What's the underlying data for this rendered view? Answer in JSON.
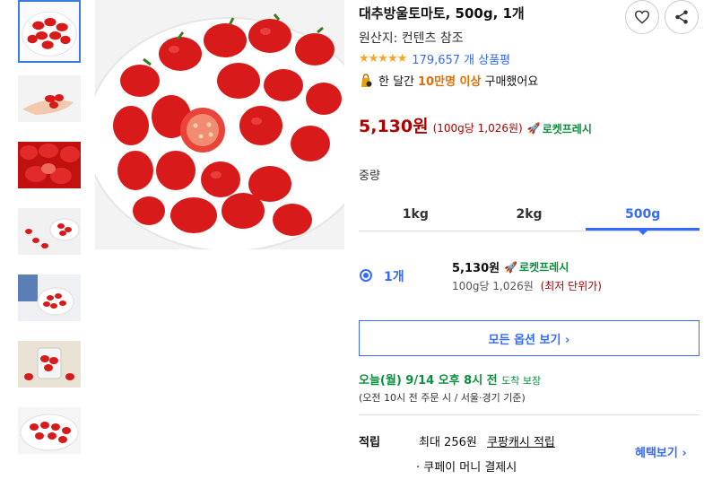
{
  "product": {
    "title": "대추방울토마토, 500g, 1개",
    "origin": "원산지: 컨텐츠 참조",
    "rating_stars": "★★★★★",
    "review_count": "179,657 개 상품평",
    "popular_prefix": "한 달간",
    "popular_highlight": "10만명 이상",
    "popular_suffix": "구매했어요"
  },
  "price": {
    "amount": "5,130원",
    "unit_price": "(100g당 1,026원)",
    "rocket_label": "로켓프레시"
  },
  "options": {
    "label": "중량",
    "tabs": [
      "1kg",
      "2kg",
      "500g"
    ],
    "selected_tab": "500g",
    "selected": {
      "qty": "1개",
      "price": "5,130원",
      "rocket_label": "로켓프레시",
      "unit": "100g당 1,026원",
      "lowest": "(최저 단위가)"
    },
    "all_options_label": "모든 옵션 보기 ›"
  },
  "delivery": {
    "arrival": "오늘(월) 9/14 오후 8시 전",
    "guarantee": "도착 보장",
    "note": "(오전 10시 전 주문 시 / 서울·경기 기준)"
  },
  "points": {
    "label": "적립",
    "max": "최대 256원",
    "link": "쿠팡캐시 적립",
    "benefit_label": "혜택보기 ›",
    "pay_label": "· 쿠페이 머니 결제시"
  },
  "icons": [
    "heart-icon",
    "share-icon",
    "rocket-icon",
    "shopping-bag-icon"
  ],
  "colors": {
    "accent_blue": "#346aff",
    "price_red": "#ae0000",
    "rocket_green": "#0a8f3d",
    "highlight_orange": "#e66c00",
    "star_yellow": "#f5a623",
    "tomato_red": "#d91a1a"
  }
}
